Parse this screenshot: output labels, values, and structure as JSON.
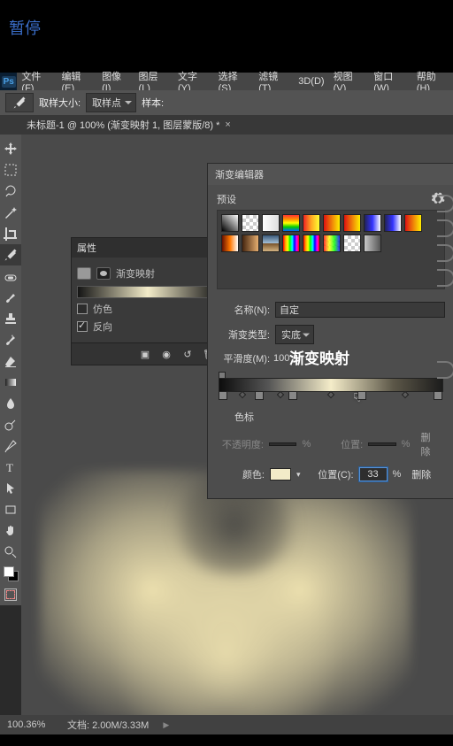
{
  "overlay": {
    "pause": "暂停"
  },
  "menu": [
    "文件(F)",
    "编辑(E)",
    "图像(I)",
    "图层(L)",
    "文字(Y)",
    "选择(S)",
    "滤镜(T)",
    "3D(D)",
    "视图(V)",
    "窗口(W)",
    "帮助(H)"
  ],
  "options_bar": {
    "sample_size_label": "取样大小:",
    "sample_size_value": "取样点",
    "sample_label": "样本:"
  },
  "document": {
    "tab_title": "未标题-1 @ 100% (渐变映射 1, 图层蒙版/8) *"
  },
  "tools": {
    "list": [
      "move",
      "marquee",
      "lasso",
      "wand",
      "crop",
      "eyedropper",
      "spot-heal",
      "brush",
      "stamp",
      "history-brush",
      "eraser",
      "gradient",
      "blur",
      "dodge",
      "pen",
      "type",
      "path-select",
      "rectangle",
      "hand",
      "zoom"
    ],
    "active": "eyedropper"
  },
  "properties": {
    "title": "属性",
    "adjustment_name": "渐变映射",
    "dither": {
      "label": "仿色",
      "checked": false
    },
    "reverse": {
      "label": "反向",
      "checked": true
    },
    "footer_icons": [
      "clip",
      "view",
      "reset",
      "trash"
    ]
  },
  "gradient_editor": {
    "title": "渐变编辑器",
    "presets_title": "预设",
    "name_label": "名称(N):",
    "name_value": "自定",
    "type_label": "渐变类型:",
    "type_value": "实底",
    "smoothness_label": "平滑度(M):",
    "smoothness_value": "100",
    "overlay_annotation": "渐变映射",
    "stops_title": "色标",
    "opacity_row": {
      "opacity_label": "不透明度:",
      "opacity_value": "",
      "opacity_unit": "%",
      "position_label": "位置:",
      "position_value": "",
      "position_unit": "%",
      "delete_label": "删除"
    },
    "color_row": {
      "color_label": "颜色:",
      "position_label": "位置(C):",
      "position_value": "33",
      "position_unit": "%",
      "delete_label": "删除"
    },
    "stop_positions_pct": [
      0,
      18,
      33,
      64,
      100
    ],
    "midpoint_positions_pct": [
      9,
      26,
      49,
      82
    ]
  },
  "status_bar": {
    "zoom": "100.36%",
    "doc_label": "文档:",
    "doc_value": "2.00M/3.33M"
  }
}
